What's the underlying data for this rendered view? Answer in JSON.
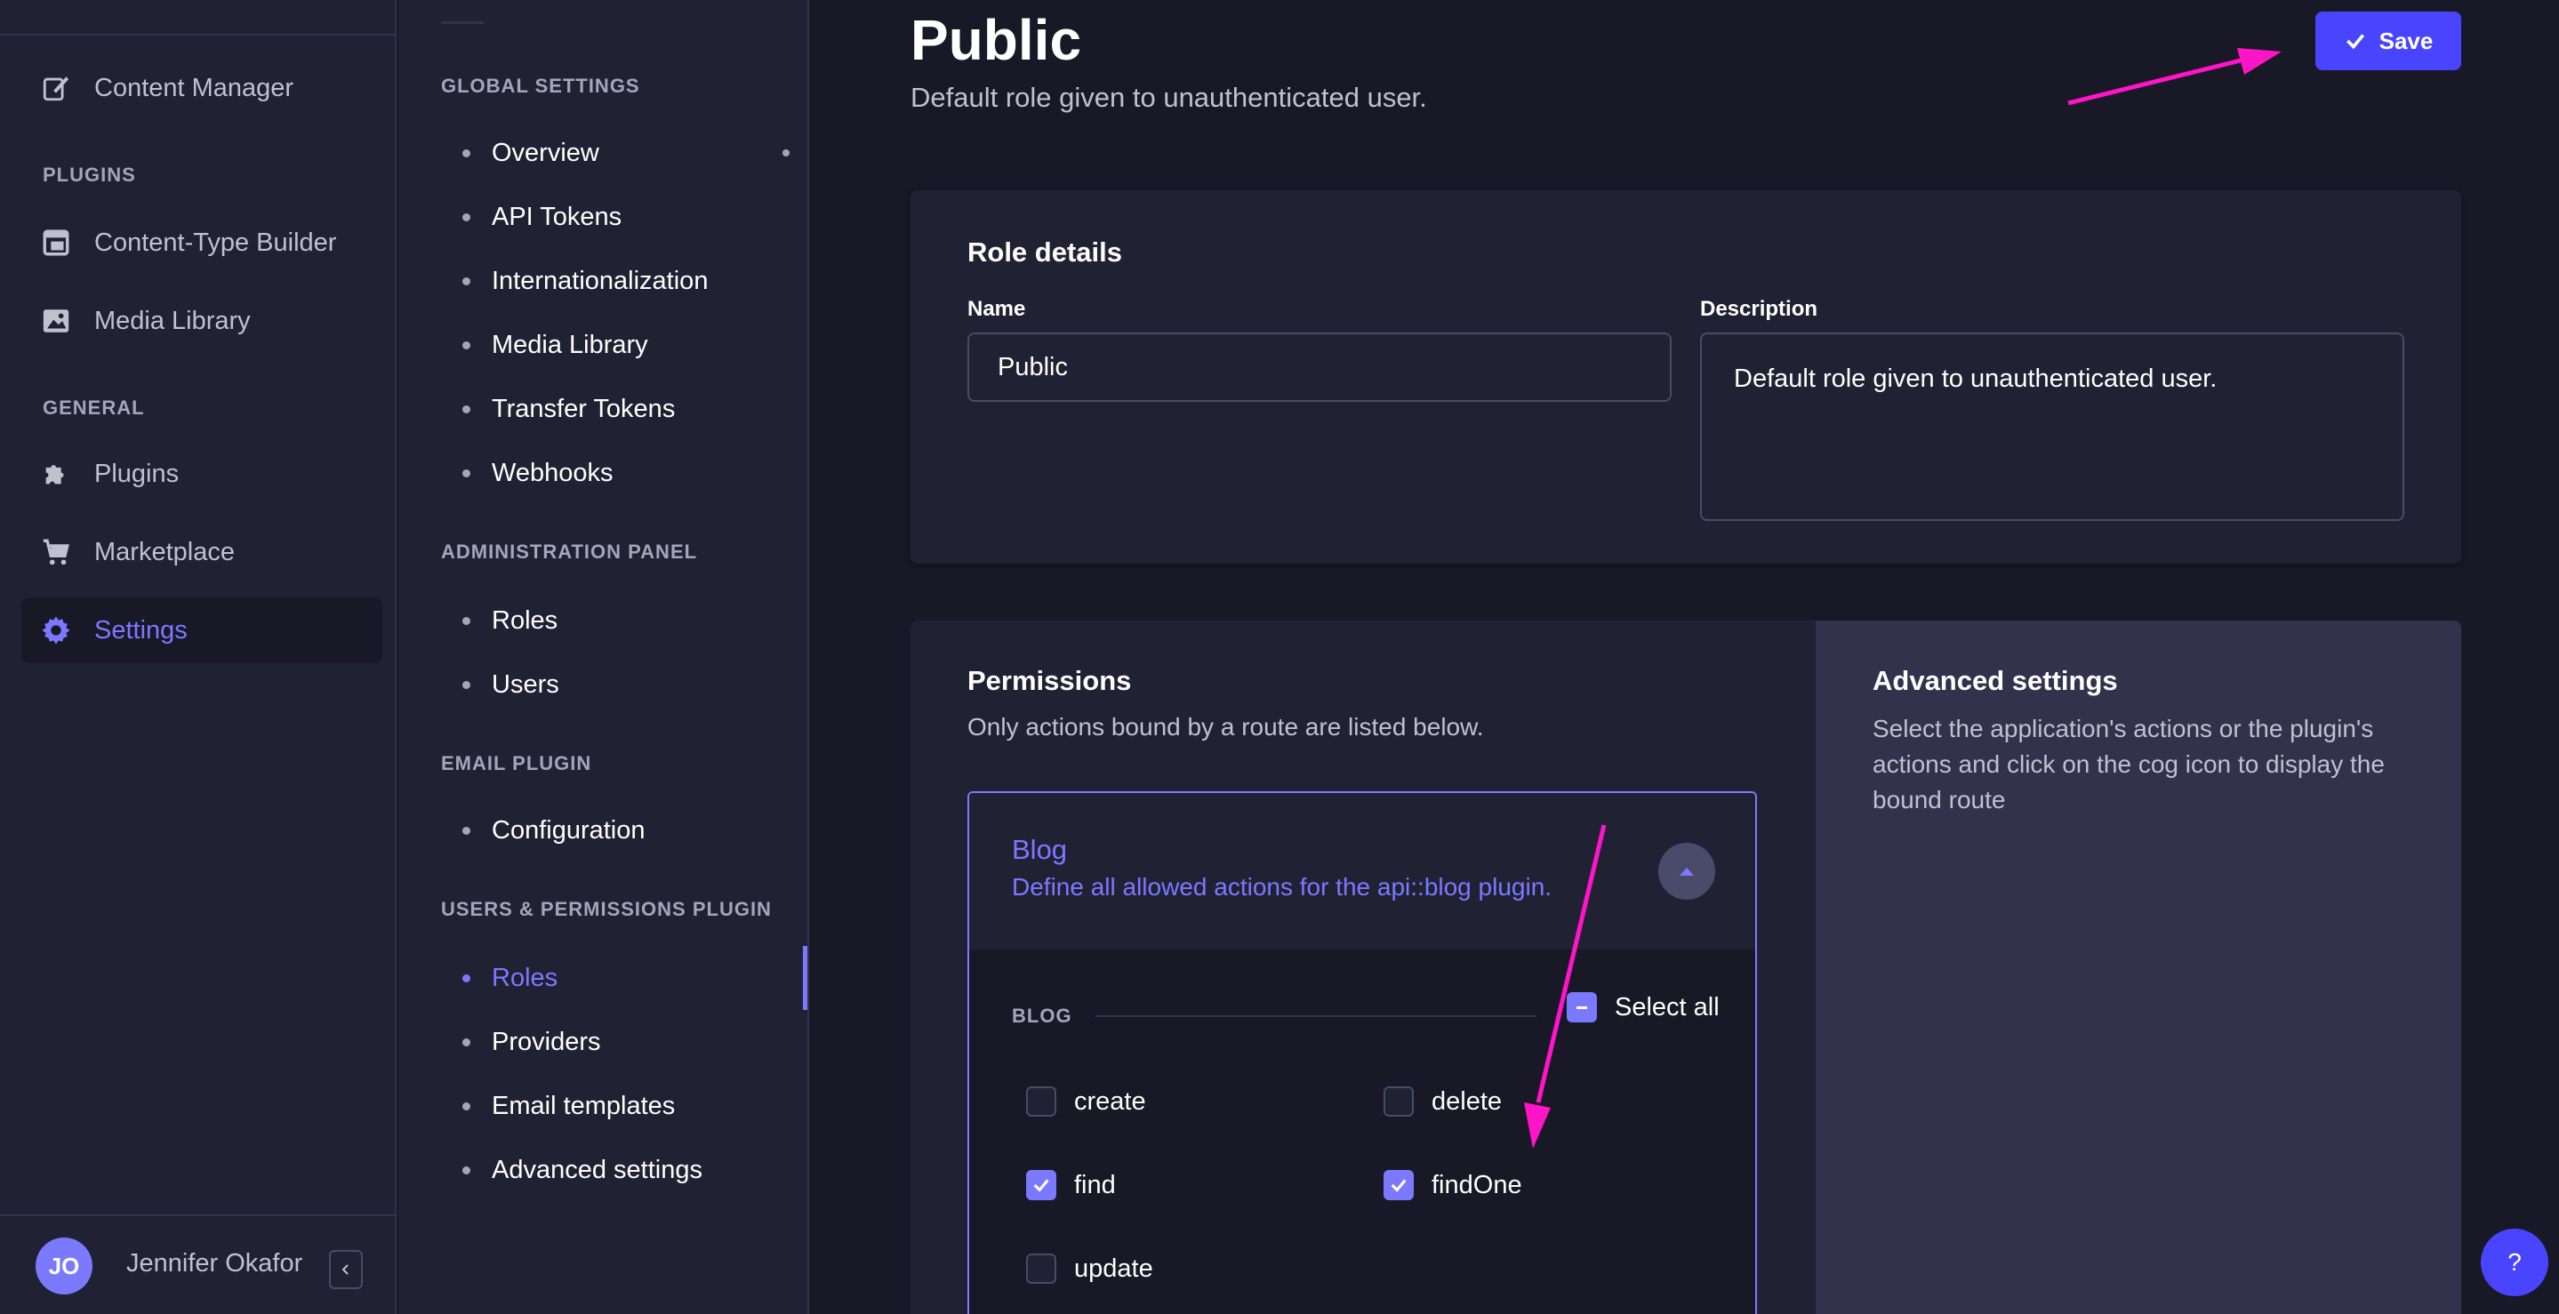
{
  "main_nav": {
    "items": [
      {
        "label": "Content Manager",
        "icon": "feather-pen-icon"
      },
      {
        "label": "Content-Type Builder",
        "icon": "layout-icon"
      },
      {
        "label": "Media Library",
        "icon": "image-icon"
      },
      {
        "label": "Plugins",
        "icon": "puzzle-icon"
      },
      {
        "label": "Marketplace",
        "icon": "cart-icon"
      },
      {
        "label": "Settings",
        "icon": "gear-icon"
      }
    ],
    "sections": {
      "plugins": "PLUGINS",
      "general": "GENERAL"
    },
    "user": {
      "initials": "JO",
      "name": "Jennifer Okafor"
    }
  },
  "settings_nav": {
    "sections": {
      "global": "GLOBAL SETTINGS",
      "admin": "ADMINISTRATION PANEL",
      "email": "EMAIL PLUGIN",
      "users_perm": "USERS & PERMISSIONS PLUGIN"
    },
    "global_items": [
      "Overview",
      "API Tokens",
      "Internationalization",
      "Media Library",
      "Transfer Tokens",
      "Webhooks"
    ],
    "admin_items": [
      "Roles",
      "Users"
    ],
    "email_items": [
      "Configuration"
    ],
    "users_perm_items": [
      "Roles",
      "Providers",
      "Email templates",
      "Advanced settings"
    ]
  },
  "header": {
    "title": "Public",
    "subtitle": "Default role given to unauthenticated user.",
    "save_label": "Save"
  },
  "role_details": {
    "title": "Role details",
    "name_label": "Name",
    "name_value": "Public",
    "description_label": "Description",
    "description_value": "Default role given to unauthenticated user."
  },
  "permissions": {
    "title": "Permissions",
    "description": "Only actions bound by a route are listed below.",
    "accordion": {
      "title": "Blog",
      "description": "Define all allowed actions for the api::blog plugin.",
      "group_label": "BLOG",
      "select_all_label": "Select all",
      "actions": [
        {
          "label": "create",
          "checked": false
        },
        {
          "label": "delete",
          "checked": false
        },
        {
          "label": "find",
          "checked": true
        },
        {
          "label": "findOne",
          "checked": true
        },
        {
          "label": "update",
          "checked": false
        }
      ]
    }
  },
  "advanced": {
    "title": "Advanced settings",
    "description": "Select the application's actions or the plugin's actions and click on the cog icon to display the bound route"
  },
  "help_label": "?",
  "colors": {
    "accent": "#7b79ff",
    "primary_button": "#4945ff",
    "annotation_arrow": "#ff14c8",
    "background": "#181826",
    "panel": "#212134"
  }
}
